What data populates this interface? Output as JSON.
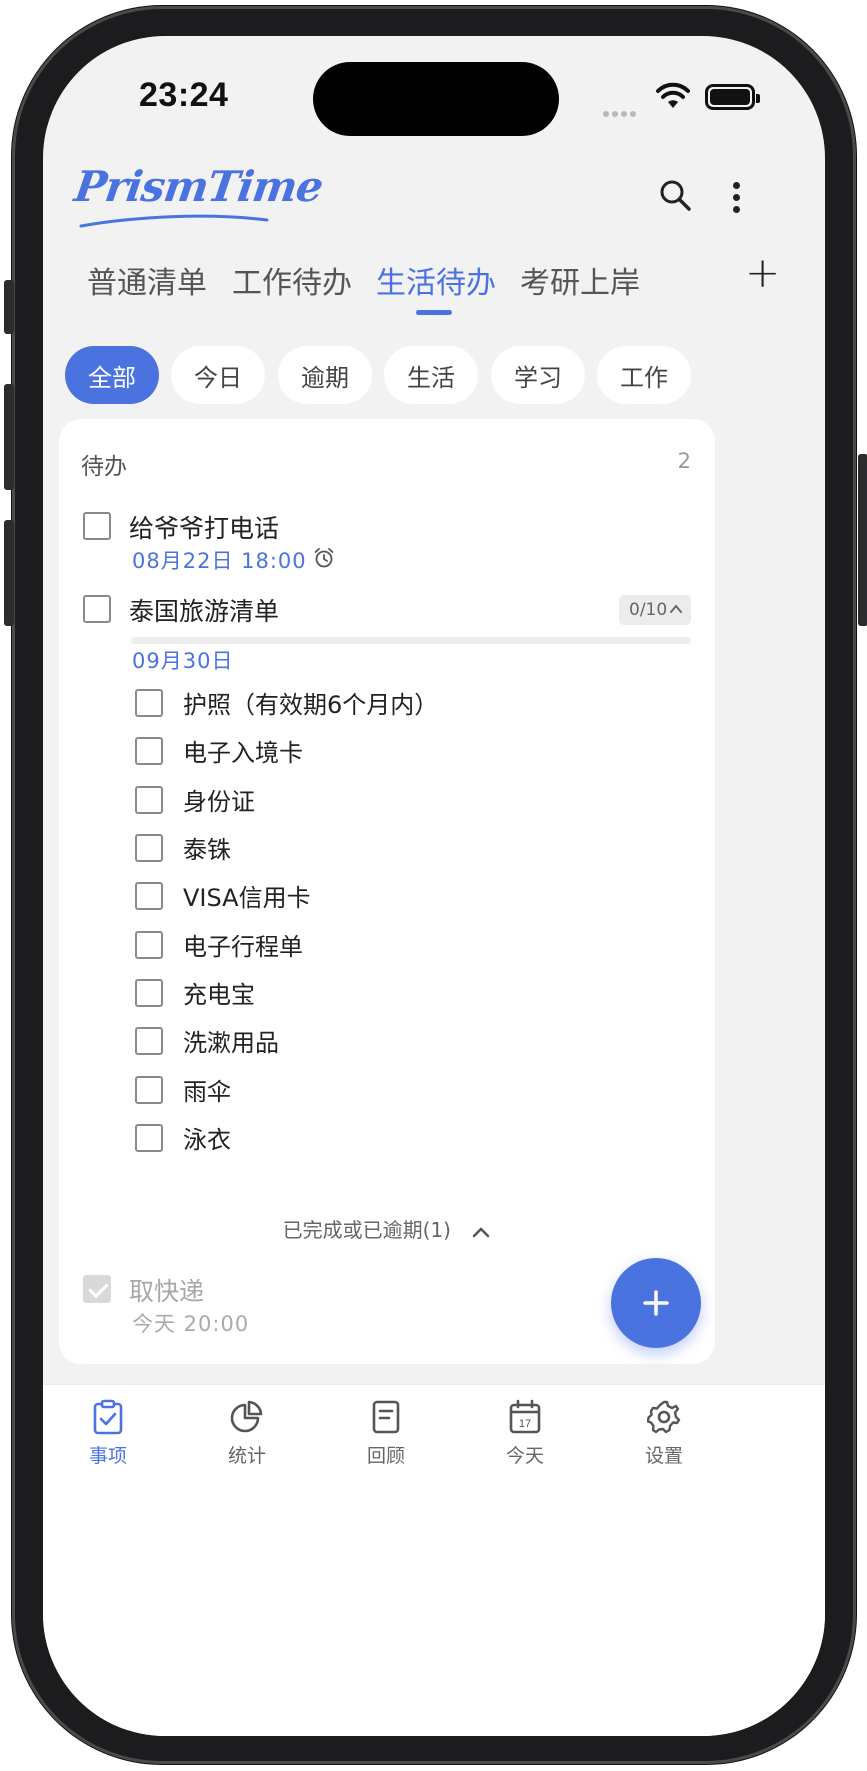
{
  "status_bar": {
    "time": "23:24"
  },
  "header": {
    "logo_text": "PrismTime",
    "tabs": [
      {
        "label": "普通清单",
        "active": false
      },
      {
        "label": "工作待办",
        "active": false
      },
      {
        "label": "生活待办",
        "active": true
      },
      {
        "label": "考研上岸",
        "active": false
      }
    ],
    "add_tab": "+"
  },
  "filters": [
    {
      "label": "全部",
      "active": true
    },
    {
      "label": "今日",
      "active": false
    },
    {
      "label": "逾期",
      "active": false
    },
    {
      "label": "生活",
      "active": false
    },
    {
      "label": "学习",
      "active": false
    },
    {
      "label": "工作",
      "active": false
    }
  ],
  "todo_section": {
    "title": "待办",
    "count": "2",
    "tasks": [
      {
        "title": "给爷爷打电话",
        "date": "08月22日  18:00",
        "has_alarm": true
      },
      {
        "title": "泰国旅游清单",
        "date": "09月30日",
        "progress_label": "0/10",
        "progress": 0,
        "subtasks": [
          "护照（有效期6个月内）",
          "电子入境卡",
          "身份证",
          "泰铢",
          "VISA信用卡",
          "电子行程单",
          "充电宝",
          "洗漱用品",
          "雨伞",
          "泳衣"
        ]
      }
    ]
  },
  "completed_section": {
    "label": "已完成或已逾期(1)",
    "tasks": [
      {
        "title": "取快递",
        "date": "今天  20:00",
        "done": true
      }
    ]
  },
  "fab": {
    "icon": "plus-icon"
  },
  "bottom_nav": [
    {
      "label": "事项",
      "icon": "clipboard-check-icon",
      "active": true
    },
    {
      "label": "统计",
      "icon": "pie-chart-icon",
      "active": false
    },
    {
      "label": "回顾",
      "icon": "document-icon",
      "active": false
    },
    {
      "label": "今天",
      "icon": "calendar-icon",
      "active": false
    },
    {
      "label": "设置",
      "icon": "gear-icon",
      "active": false
    }
  ],
  "colors": {
    "accent": "#4a73e0",
    "background": "#f2f2f2",
    "card": "#ffffff"
  }
}
